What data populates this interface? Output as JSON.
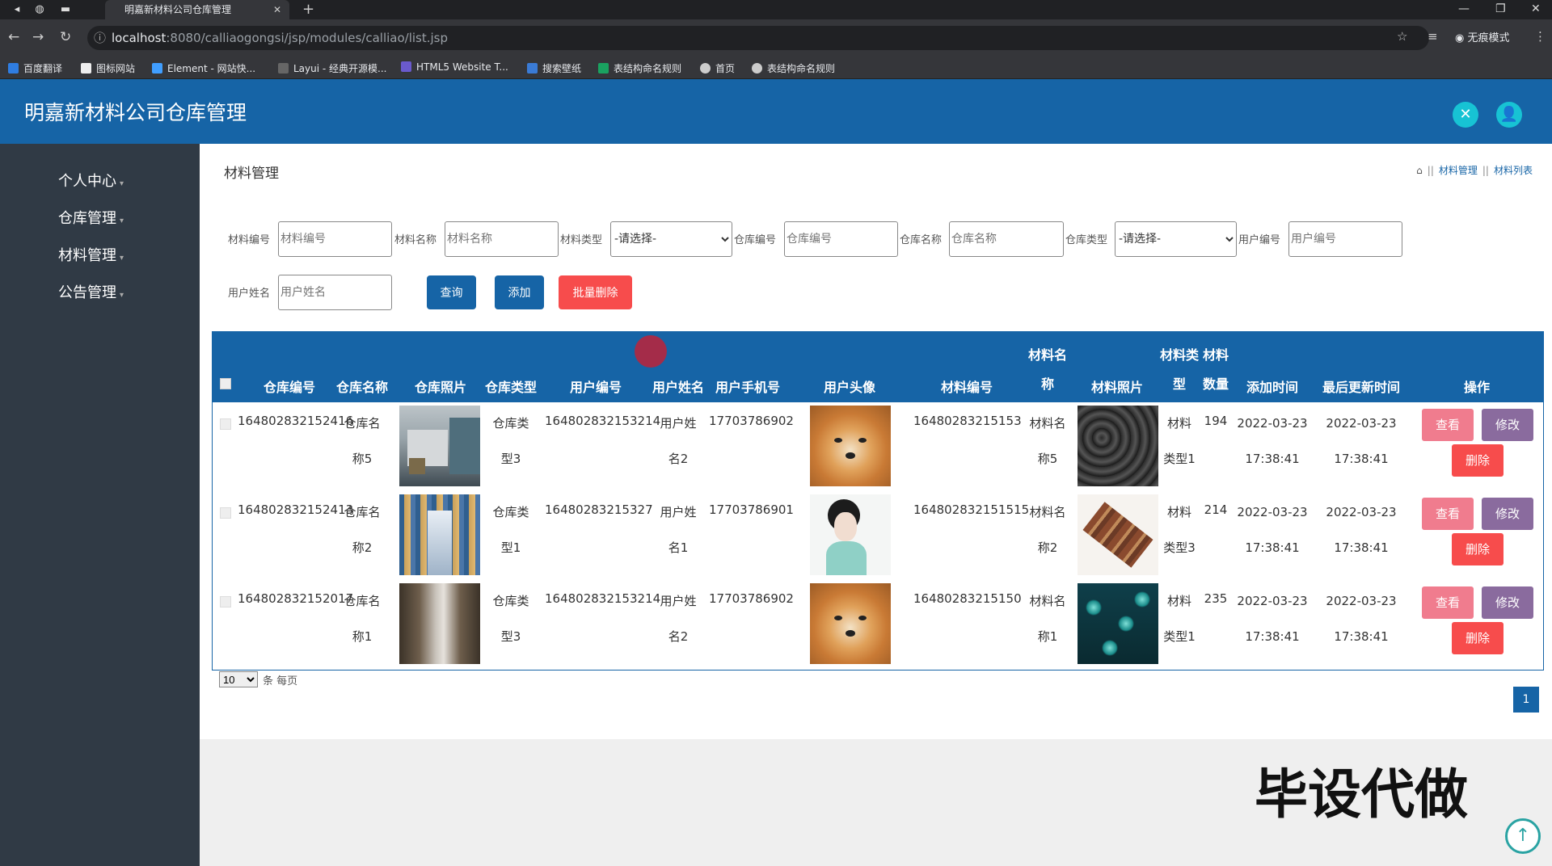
{
  "browser": {
    "tab_title": "明嘉新材料公司仓库管理",
    "url_host": "localhost",
    "url_path": ":8080/calliaogongsi/jsp/modules/calliao/list.jsp",
    "incognito_label": "无痕模式",
    "bookmarks": [
      "百度翻译",
      "图标网站",
      "Element - 网站快...",
      "Layui - 经典开源模...",
      "HTML5 Website T...",
      "搜索壁纸",
      "表结构命名规则",
      "首页",
      "表结构命名规则"
    ]
  },
  "app": {
    "title": "明嘉新材料公司仓库管理"
  },
  "sidebar": {
    "items": [
      "个人中心",
      "仓库管理",
      "材料管理",
      "公告管理"
    ]
  },
  "page": {
    "title": "材料管理",
    "breadcrumb": [
      "材料管理",
      "材料列表"
    ]
  },
  "filters": {
    "cailiaobianhao": {
      "label": "材料编号",
      "placeholder": "材料编号"
    },
    "cailiaomingcheng": {
      "label": "材料名称",
      "placeholder": "材料名称"
    },
    "cailiaoleixing": {
      "label": "材料类型",
      "value": "-请选择-"
    },
    "cangkubianhao": {
      "label": "仓库编号",
      "placeholder": "仓库编号"
    },
    "cangkumingcheng": {
      "label": "仓库名称",
      "placeholder": "仓库名称"
    },
    "cangkuleixing": {
      "label": "仓库类型",
      "value": "-请选择-"
    },
    "yonghubianhao": {
      "label": "用户编号",
      "placeholder": "用户编号"
    },
    "yonghuxingming": {
      "label": "用户姓名",
      "placeholder": "用户姓名"
    }
  },
  "buttons": {
    "search": "查询",
    "add": "添加",
    "batch_delete": "批量删除",
    "view": "查看",
    "edit": "修改",
    "delete": "删除"
  },
  "colors": {
    "primary": "#1664a6",
    "danger": "#f74c4c",
    "view": "#f07c8e",
    "edit": "#8a6b9e",
    "sidebar": "#303a45"
  },
  "table": {
    "headers": [
      "仓库编号",
      "仓库名称",
      "仓库照片",
      "仓库类型",
      "用户编号",
      "用户姓名",
      "用户手机号",
      "用户头像",
      "材料编号",
      "材料名称",
      "材料照片",
      "材料类型",
      "材料数量",
      "添加时间",
      "最后更新时间",
      "操作"
    ],
    "rows": [
      {
        "cangku_bianhao": "164802832152416",
        "cangku_mingcheng": [
          "仓库名",
          "称5"
        ],
        "cangku_leixing": [
          "仓库类",
          "型3"
        ],
        "yonghu_bianhao": "164802832153214",
        "yonghu_xingming": [
          "用户姓",
          "名2"
        ],
        "shouji": "17703786902",
        "cailiao_bianhao": "16480283215153",
        "cailiao_mingcheng": [
          "材料名",
          "称5"
        ],
        "cailiao_leixing": [
          "材料",
          "类型1"
        ],
        "shuliang": "194",
        "add_time": [
          "2022-03-23",
          "17:38:41"
        ],
        "update_time": [
          "2022-03-23",
          "17:38:41"
        ],
        "cangku_photo": "warehouse-loading-dock",
        "avatar": "shiba-dog",
        "cailiao_photo": "dark-marble-texture"
      },
      {
        "cangku_bianhao": "164802832152413",
        "cangku_mingcheng": [
          "仓库名",
          "称2"
        ],
        "cangku_leixing": [
          "仓库类",
          "型1"
        ],
        "yonghu_bianhao": "16480283215327",
        "yonghu_xingming": [
          "用户姓",
          "名1"
        ],
        "shouji": "17703786901",
        "cailiao_bianhao": "164802832151515",
        "cailiao_mingcheng": [
          "材料名",
          "称2"
        ],
        "cailiao_leixing": [
          "材料",
          "类型3"
        ],
        "shuliang": "214",
        "add_time": [
          "2022-03-23",
          "17:38:41"
        ],
        "update_time": [
          "2022-03-23",
          "17:38:41"
        ],
        "cangku_photo": "warehouse-shelves",
        "avatar": "woman-portrait",
        "cailiao_photo": "wood-planks"
      },
      {
        "cangku_bianhao": "164802832152017",
        "cangku_mingcheng": [
          "仓库名",
          "称1"
        ],
        "cangku_leixing": [
          "仓库类",
          "型3"
        ],
        "yonghu_bianhao": "164802832153214",
        "yonghu_xingming": [
          "用户姓",
          "名2"
        ],
        "shouji": "17703786902",
        "cailiao_bianhao": "16480283215150",
        "cailiao_mingcheng": [
          "材料名",
          "称1"
        ],
        "cailiao_leixing": [
          "材料",
          "类型1"
        ],
        "shuliang": "235",
        "add_time": [
          "2022-03-23",
          "17:38:41"
        ],
        "update_time": [
          "2022-03-23",
          "17:38:41"
        ],
        "cangku_photo": "warehouse-aisle",
        "avatar": "shiba-dog",
        "cailiao_photo": "teal-spheres"
      }
    ]
  },
  "pagination": {
    "page_size": "10",
    "page_size_suffix": "条 每页",
    "current_page": "1"
  },
  "watermark": "毕设代做"
}
